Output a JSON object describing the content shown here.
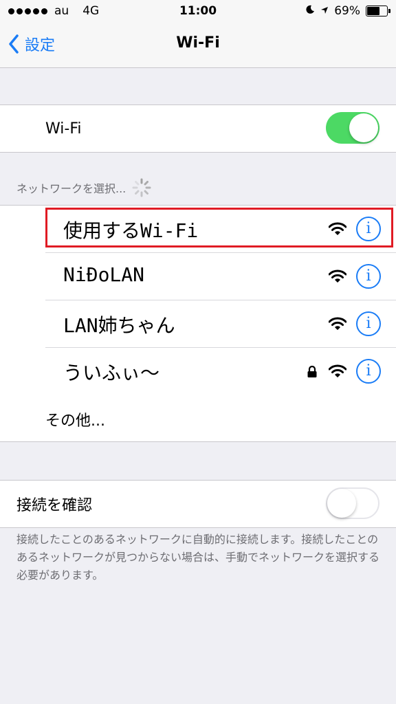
{
  "status_bar": {
    "carrier": "au",
    "network": "4G",
    "time": "11:00",
    "battery_percent_label": "69%",
    "battery_level": 0.69,
    "signal_dots_filled": 5
  },
  "nav": {
    "back_label": "設定",
    "title": "Wi-Fi"
  },
  "wifi_toggle": {
    "label": "Wi-Fi",
    "state": "on"
  },
  "networks_section": {
    "header": "ネットワークを選択..."
  },
  "networks": [
    {
      "name": "使用するWi-Fi",
      "locked": false
    },
    {
      "name": "NiĐoLAN",
      "locked": false
    },
    {
      "name": "LAN姉ちゃん",
      "locked": false
    },
    {
      "name": "ういふぃ〜",
      "locked": true
    }
  ],
  "other_label": "その他...",
  "ask_to_join": {
    "label": "接続を確認",
    "state": "off"
  },
  "footer": {
    "text": "接続したことのあるネットワークに自動的に接続します。接続したことのあるネットワークが見つからない場合は、手動でネットワークを選択する必要があります。"
  },
  "colors": {
    "accent": "#1a7cf6",
    "toggle_on": "#4cd964",
    "highlight": "#e01b24"
  }
}
